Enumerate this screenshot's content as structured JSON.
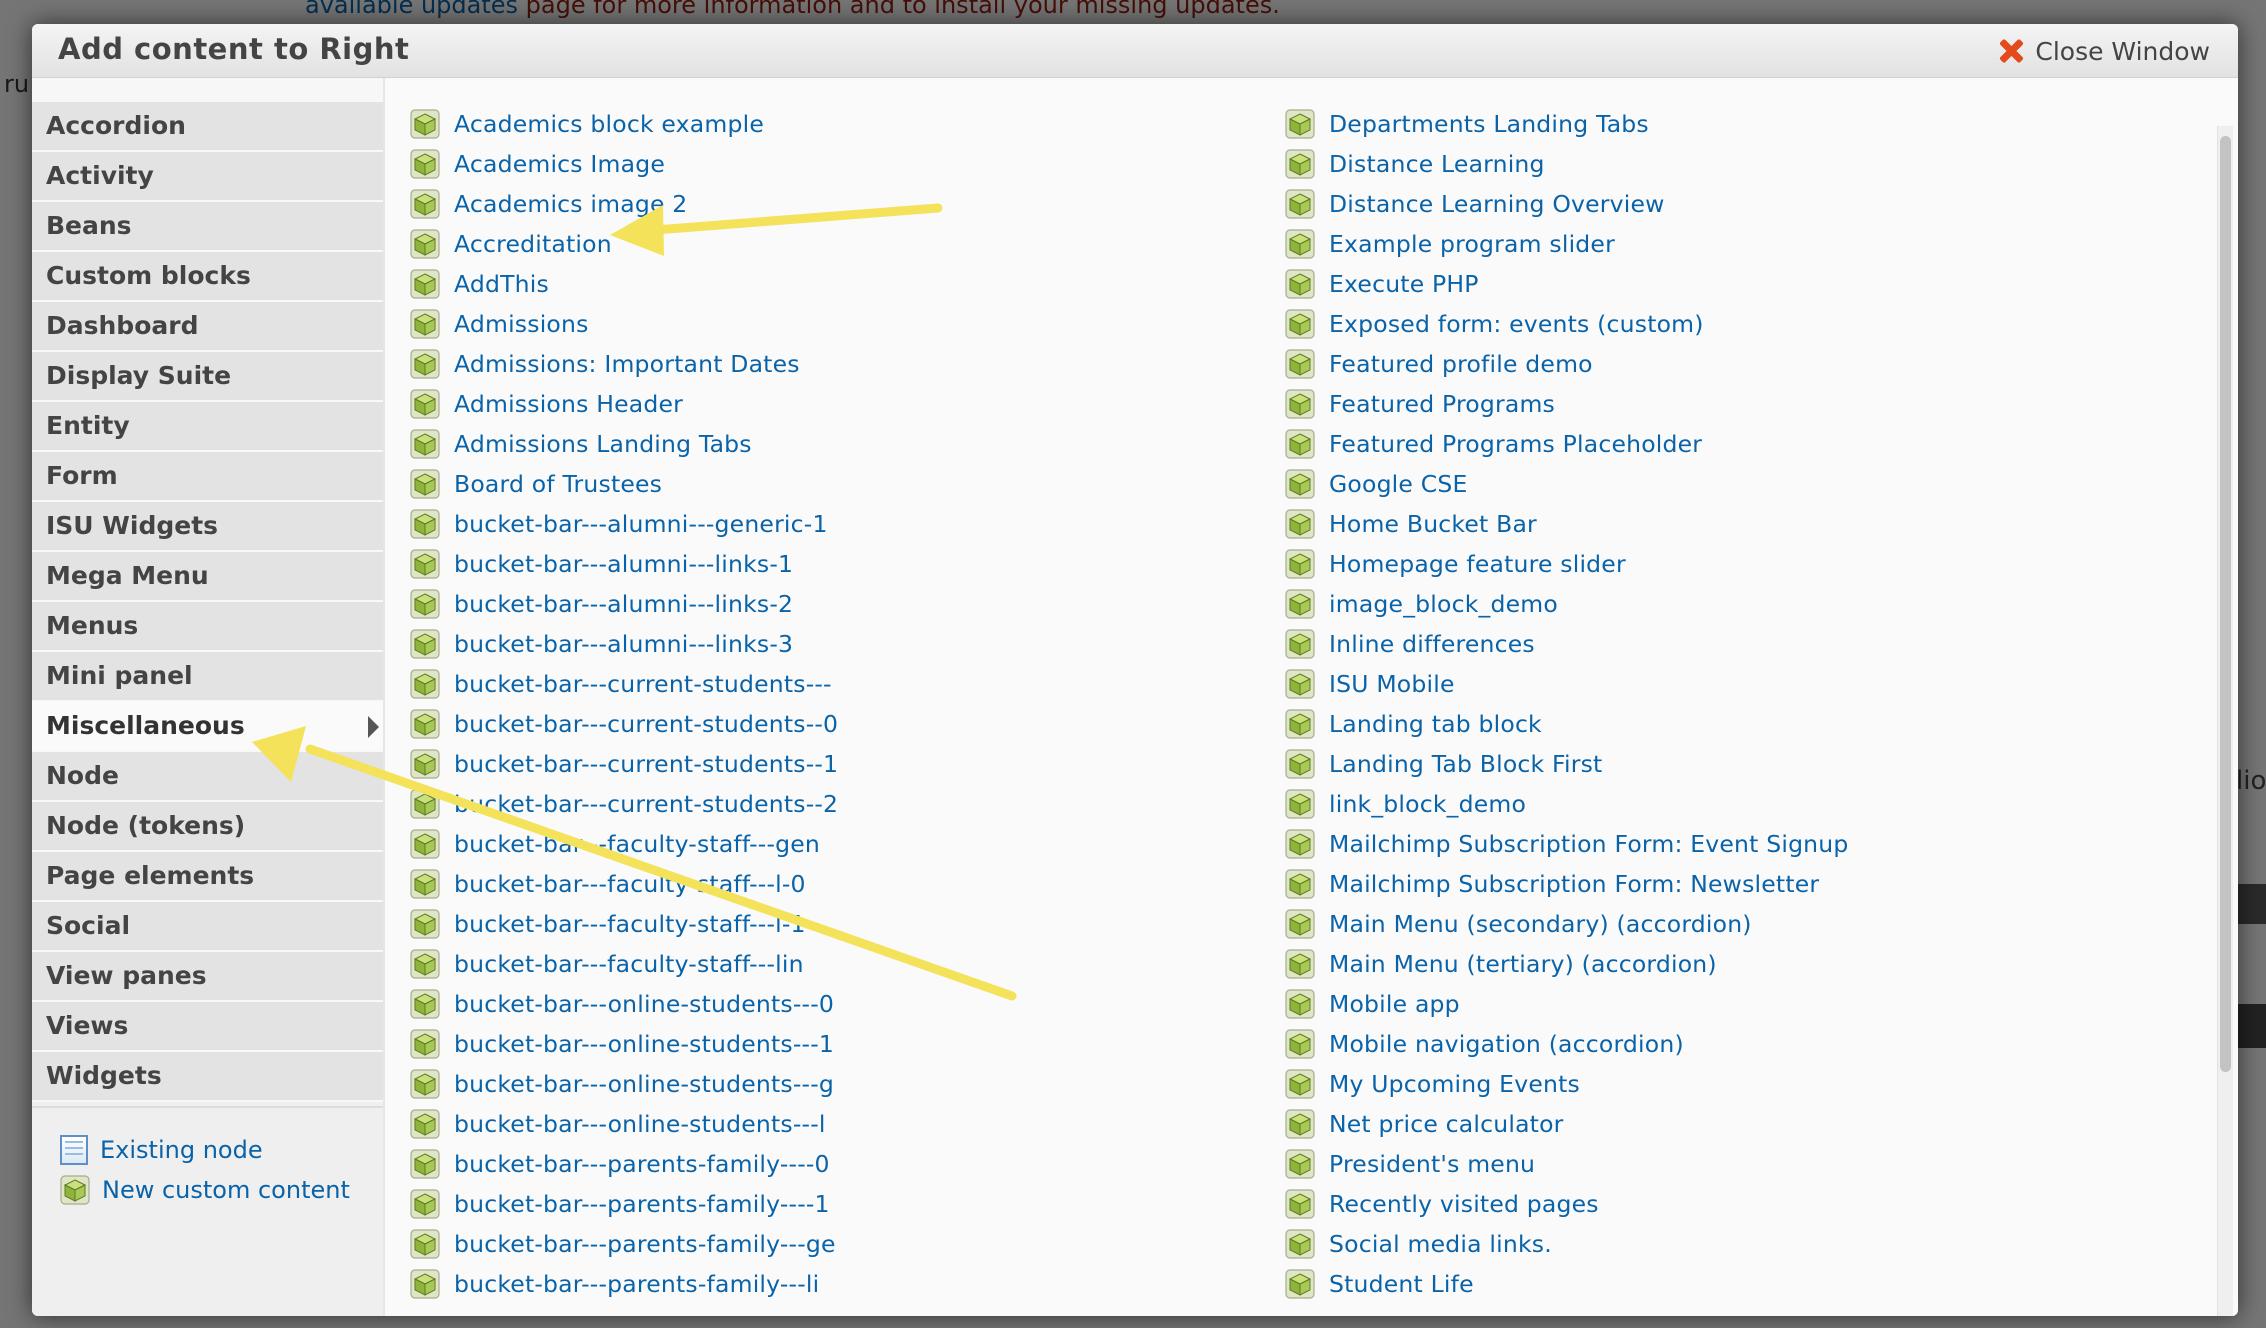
{
  "background": {
    "notice_link": "available updates",
    "notice_text": " page for more information and to install your missing updates.",
    "left_fragment": "ru",
    "right_fragment": "lio"
  },
  "modal": {
    "title": "Add content to Right",
    "close_label": "Close Window"
  },
  "sidebar": {
    "categories": [
      {
        "label": "Accordion"
      },
      {
        "label": "Activity"
      },
      {
        "label": "Beans"
      },
      {
        "label": "Custom blocks"
      },
      {
        "label": "Dashboard"
      },
      {
        "label": "Display Suite"
      },
      {
        "label": "Entity"
      },
      {
        "label": "Form"
      },
      {
        "label": "ISU Widgets"
      },
      {
        "label": "Mega Menu"
      },
      {
        "label": "Menus"
      },
      {
        "label": "Mini panel"
      },
      {
        "label": "Miscellaneous",
        "active": true
      },
      {
        "label": "Node"
      },
      {
        "label": "Node (tokens)"
      },
      {
        "label": "Page elements"
      },
      {
        "label": "Social"
      },
      {
        "label": "View panes"
      },
      {
        "label": "Views"
      },
      {
        "label": "Widgets"
      }
    ],
    "extras": [
      {
        "label": "Existing node",
        "icon": "document-icon"
      },
      {
        "label": "New custom content",
        "icon": "block-icon"
      }
    ]
  },
  "content": {
    "column_1": [
      "Academics block example",
      "Academics Image",
      "Academics image 2",
      "Accreditation",
      "AddThis",
      "Admissions",
      "Admissions: Important Dates",
      "Admissions Header",
      "Admissions Landing Tabs",
      "Board of Trustees",
      "bucket-bar---alumni---generic-1",
      "bucket-bar---alumni---links-1",
      "bucket-bar---alumni---links-2",
      "bucket-bar---alumni---links-3",
      "bucket-bar---current-students---",
      "bucket-bar---current-students--0",
      "bucket-bar---current-students--1",
      "bucket-bar---current-students--2",
      "bucket-bar---faculty-staff---gen",
      "bucket-bar---faculty-staff---l-0",
      "bucket-bar---faculty-staff---l-1",
      "bucket-bar---faculty-staff---lin",
      "bucket-bar---online-students---0",
      "bucket-bar---online-students---1",
      "bucket-bar---online-students---g",
      "bucket-bar---online-students---l",
      "bucket-bar---parents-family----0",
      "bucket-bar---parents-family----1",
      "bucket-bar---parents-family---ge",
      "bucket-bar---parents-family---li"
    ],
    "column_2": [
      "Departments Landing Tabs",
      "Distance Learning",
      "Distance Learning Overview",
      "Example program slider",
      "Execute PHP",
      "Exposed form: events (custom)",
      "Featured profile demo",
      "Featured Programs",
      "Featured Programs Placeholder",
      "Google CSE",
      "Home Bucket Bar",
      "Homepage feature slider",
      "image_block_demo",
      "Inline differences",
      "ISU Mobile",
      "Landing tab block",
      "Landing Tab Block First",
      "link_block_demo",
      "Mailchimp Subscription Form: Event Signup",
      "Mailchimp Subscription Form: Newsletter",
      "Main Menu (secondary) (accordion)",
      "Main Menu (tertiary) (accordion)",
      "Mobile app",
      "Mobile navigation (accordion)",
      "My Upcoming Events",
      "Net price calculator",
      "President's menu",
      "Recently visited pages",
      "Social media links.",
      "Student Life"
    ]
  },
  "colors": {
    "link": "#0a63a8",
    "annotation_arrow": "#f3e25a",
    "close_icon": "#e34a1c",
    "block_icon": "#9cc24a"
  }
}
